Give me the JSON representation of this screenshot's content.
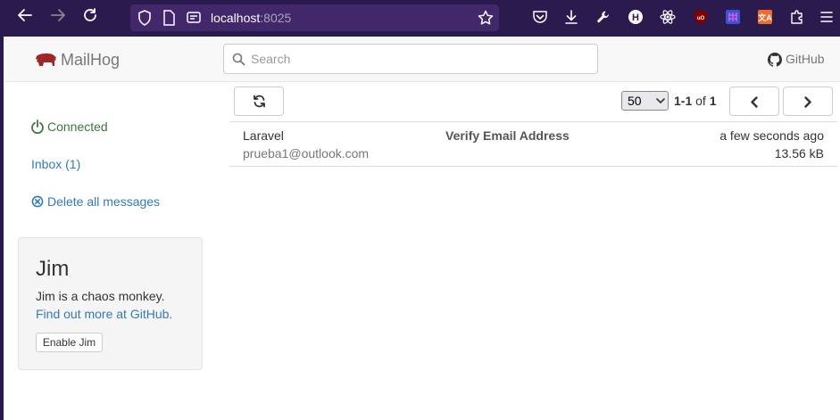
{
  "browser": {
    "url_host": "localhost",
    "url_port": ":8025"
  },
  "navbar": {
    "brand": "MailHog",
    "search_placeholder": "Search",
    "github_label": "GitHub"
  },
  "sidebar": {
    "connected_label": "Connected",
    "inbox_label": "Inbox (1)",
    "delete_label": "Delete all messages"
  },
  "jim": {
    "title": "Jim",
    "description": "Jim is a chaos monkey.",
    "link_text": "Find out more at GitHub.",
    "button_label": "Enable Jim"
  },
  "toolbar": {
    "page_size": "50",
    "range": "1-1",
    "of_label": "of",
    "total": "1"
  },
  "messages": [
    {
      "from": "Laravel",
      "to": "prueba1@outlook.com",
      "subject": "Verify Email Address",
      "date": "a few seconds ago",
      "size": "13.56 kB"
    }
  ],
  "colors": {
    "browser_bg": "#2b1a4d",
    "url_bg": "#42286b",
    "link": "#337ab7",
    "connected": "#3c763d",
    "brand_logo": "#9e2626"
  }
}
